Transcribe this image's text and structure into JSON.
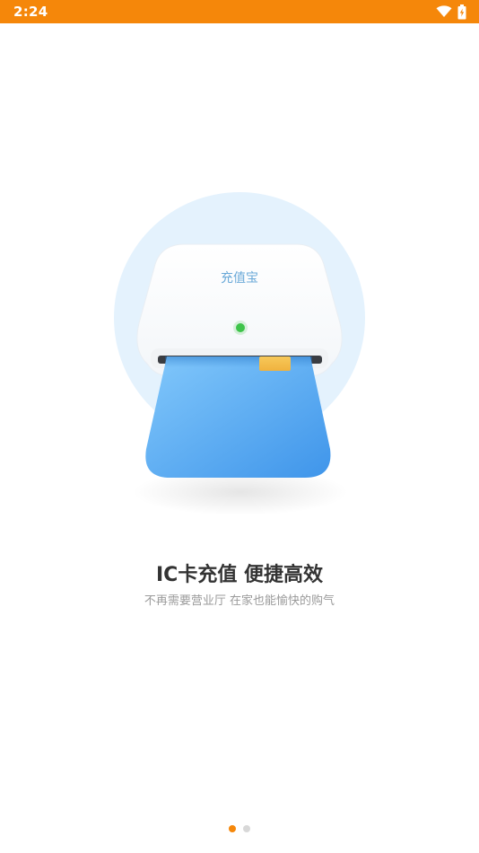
{
  "status_bar": {
    "time": "2:24",
    "background": "#f5870a",
    "icons": [
      "wifi-icon",
      "battery-charging-icon"
    ]
  },
  "illustration": {
    "device_label": "充值宝",
    "accent": "#5aa8f0",
    "led_color": "#3ec44a"
  },
  "onboarding": {
    "title": "IC卡充值 便捷高效",
    "subtitle": "不再需要营业厅 在家也能愉快的购气"
  },
  "pager": {
    "pages": 2,
    "current": 1,
    "active_color": "#f5870a",
    "inactive_color": "#d8d8d8"
  }
}
